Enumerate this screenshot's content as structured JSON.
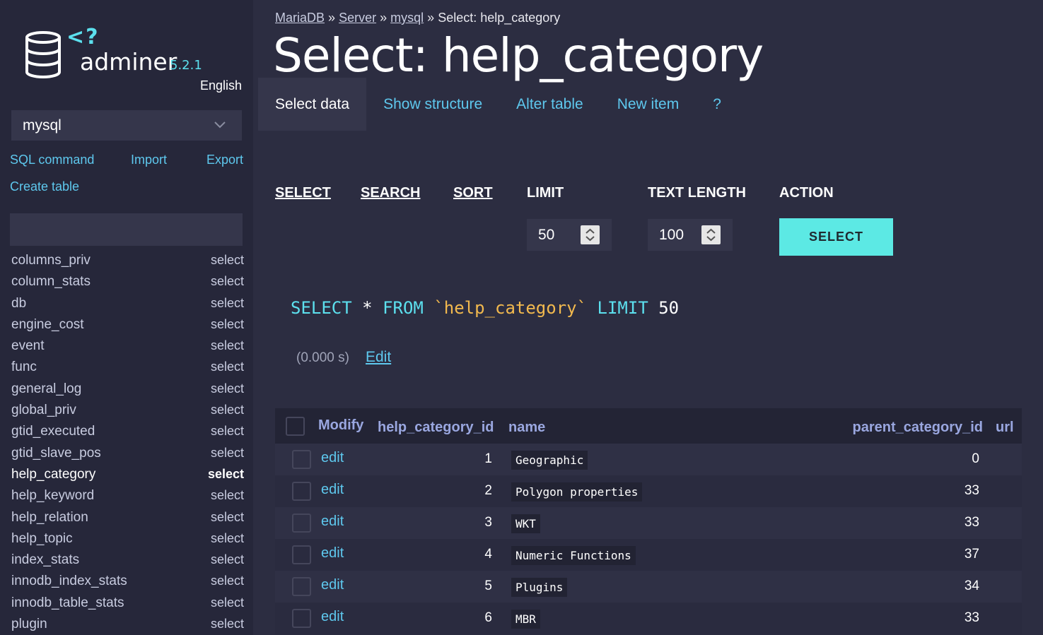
{
  "app": {
    "name": "adminer",
    "version": "5.2.1",
    "language": "English"
  },
  "sidebar": {
    "database": "mysql",
    "links": {
      "sql_command": "SQL command",
      "import": "Import",
      "export": "Export",
      "create_table": "Create table"
    },
    "search_value": "",
    "tables": [
      {
        "name": "columns_priv",
        "action": "select"
      },
      {
        "name": "column_stats",
        "action": "select"
      },
      {
        "name": "db",
        "action": "select"
      },
      {
        "name": "engine_cost",
        "action": "select"
      },
      {
        "name": "event",
        "action": "select"
      },
      {
        "name": "func",
        "action": "select"
      },
      {
        "name": "general_log",
        "action": "select"
      },
      {
        "name": "global_priv",
        "action": "select"
      },
      {
        "name": "gtid_executed",
        "action": "select"
      },
      {
        "name": "gtid_slave_pos",
        "action": "select"
      },
      {
        "name": "help_category",
        "action": "select",
        "active": true
      },
      {
        "name": "help_keyword",
        "action": "select"
      },
      {
        "name": "help_relation",
        "action": "select"
      },
      {
        "name": "help_topic",
        "action": "select"
      },
      {
        "name": "index_stats",
        "action": "select"
      },
      {
        "name": "innodb_index_stats",
        "action": "select"
      },
      {
        "name": "innodb_table_stats",
        "action": "select"
      },
      {
        "name": "plugin",
        "action": "select"
      }
    ]
  },
  "breadcrumb": {
    "mariadb": "MariaDB",
    "sep": "»",
    "server": "Server",
    "db": "mysql",
    "current": "Select: help_category"
  },
  "page_title": "Select: help_category",
  "tabs": [
    "Select data",
    "Show structure",
    "Alter table",
    "New item",
    "?"
  ],
  "select_form": {
    "headers": {
      "select": "SELECT",
      "search": "SEARCH",
      "sort": "SORT",
      "limit": "LIMIT",
      "text_length": "TEXT LENGTH",
      "action": "ACTION"
    },
    "limit": "50",
    "text_length": "100",
    "button": "SELECT"
  },
  "query": {
    "kw1": "SELECT",
    "star": "*",
    "kw2": "FROM",
    "table": "`help_category`",
    "kw3": "LIMIT",
    "limit": "50"
  },
  "timing": "(0.000 s)",
  "edit_link": "Edit",
  "grid": {
    "columns": {
      "modify": "Modify",
      "id": "help_category_id",
      "name": "name",
      "parent": "parent_category_id",
      "url": "url"
    },
    "rows": [
      {
        "edit": "edit",
        "id": "1",
        "name": "Geographic",
        "parent": "0"
      },
      {
        "edit": "edit",
        "id": "2",
        "name": "Polygon properties",
        "parent": "33"
      },
      {
        "edit": "edit",
        "id": "3",
        "name": "WKT",
        "parent": "33"
      },
      {
        "edit": "edit",
        "id": "4",
        "name": "Numeric Functions",
        "parent": "37"
      },
      {
        "edit": "edit",
        "id": "5",
        "name": "Plugins",
        "parent": "34"
      },
      {
        "edit": "edit",
        "id": "6",
        "name": "MBR",
        "parent": "33"
      }
    ]
  },
  "colors": {
    "accent": "#5ce0ee",
    "link": "#5ec8ee",
    "button": "#5ce9e4",
    "identifier": "#f2b94e",
    "background": "#2c2d41",
    "sidebar": "#26273a"
  }
}
